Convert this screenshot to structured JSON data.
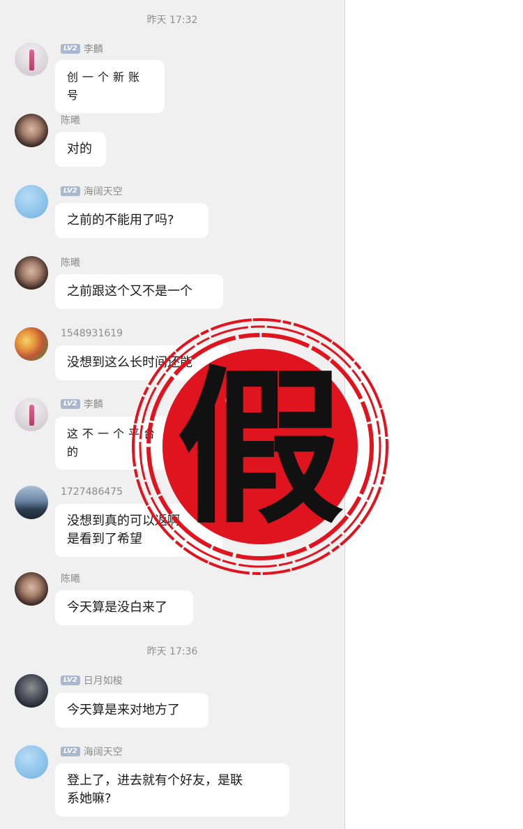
{
  "timestamps": [
    "昨天 17:32",
    "昨天 17:36"
  ],
  "messages": [
    {
      "sender": "李麟",
      "level": "LV2",
      "text": "创一个新账号",
      "avatar": "bottle-avatar"
    },
    {
      "sender": "陈曦",
      "level": "",
      "text": "对的",
      "avatar": "girl-avatar"
    },
    {
      "sender": "海阔天空",
      "level": "LV2",
      "text": "之前的不能用了吗?",
      "avatar": "sky-avatar"
    },
    {
      "sender": "陈曦",
      "level": "",
      "text": "之前跟这个又不是一个",
      "avatar": "girl-avatar"
    },
    {
      "sender": "1548931619",
      "level": "",
      "text": "没想到这么长时间还能",
      "avatar": "flowers-avatar"
    },
    {
      "sender": "李麟",
      "level": "LV2",
      "text": "这不一个平台",
      "text2": "的",
      "avatar": "bottle-avatar"
    },
    {
      "sender": "1727486475",
      "level": "",
      "text": "没想到真的可以返啊",
      "text2": "是看到了希望",
      "avatar": "mountain-avatar"
    },
    {
      "sender": "陈曦",
      "level": "",
      "text": "今天算是没白来了",
      "avatar": "girl-avatar"
    },
    {
      "sender": "日月如梭",
      "level": "LV2",
      "text": "今天算是来对地方了",
      "avatar": "night-avatar"
    },
    {
      "sender": "海阔天空",
      "level": "LV2",
      "text": "登上了，进去就有个好友，是联",
      "text2": "系她嘛?",
      "avatar": "sky-avatar"
    }
  ],
  "stamp": {
    "character": "假",
    "color": "#e0141e"
  }
}
